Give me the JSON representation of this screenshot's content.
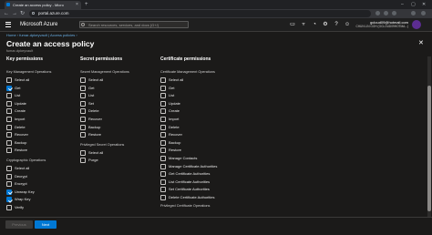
{
  "browser": {
    "tab_title": "Create an access policy - Micro",
    "tab_close": "×",
    "new_tab": "+",
    "url": "portal.azure.com",
    "window_controls": {
      "minimize": "–",
      "maximize": "▢",
      "close": "✕"
    },
    "nav": {
      "back": "←",
      "forward": "→",
      "reload": "↻"
    }
  },
  "azure": {
    "brand": "Microsoft Azure",
    "search_placeholder": "Search resources, services, and docs (G+/)",
    "user_email": "gcloud09@hotmail.com",
    "user_tenant": "CHUN LIN GOH (GCLOUD09HOTMA...)",
    "header_icons": [
      "terminal-icon",
      "bell-icon",
      "gear-icon",
      "help-icon",
      "feedback-icon"
    ]
  },
  "page": {
    "breadcrumb": "Home  ›  fumar-dpkeyvault  |  Access policies  ›",
    "title": "Create an access policy",
    "title_ellipsis": "···",
    "subtitle": "fumar-dpkeyvault",
    "close": "✕"
  },
  "columns": {
    "key": {
      "heading": "Key permissions",
      "groups": [
        {
          "label": "Key Management Operations",
          "items": [
            {
              "label": "Select all",
              "checked": false
            },
            {
              "label": "Get",
              "checked": true
            },
            {
              "label": "List",
              "checked": false
            },
            {
              "label": "Update",
              "checked": false
            },
            {
              "label": "Create",
              "checked": false
            },
            {
              "label": "Import",
              "checked": false
            },
            {
              "label": "Delete",
              "checked": false
            },
            {
              "label": "Recover",
              "checked": false
            },
            {
              "label": "Backup",
              "checked": false
            },
            {
              "label": "Restore",
              "checked": false
            }
          ]
        },
        {
          "label": "Cryptographic Operations",
          "items": [
            {
              "label": "Select all",
              "checked": false
            },
            {
              "label": "Decrypt",
              "checked": false
            },
            {
              "label": "Encrypt",
              "checked": false
            },
            {
              "label": "Unwrap Key",
              "checked": true
            },
            {
              "label": "Wrap Key",
              "checked": true
            },
            {
              "label": "Verify",
              "checked": false
            }
          ]
        }
      ]
    },
    "secret": {
      "heading": "Secret permissions",
      "groups": [
        {
          "label": "Secret Management Operations",
          "items": [
            {
              "label": "Select all",
              "checked": false
            },
            {
              "label": "Get",
              "checked": false
            },
            {
              "label": "List",
              "checked": false
            },
            {
              "label": "Set",
              "checked": false
            },
            {
              "label": "Delete",
              "checked": false
            },
            {
              "label": "Recover",
              "checked": false
            },
            {
              "label": "Backup",
              "checked": false
            },
            {
              "label": "Restore",
              "checked": false
            }
          ]
        },
        {
          "label": "Privileged Secret Operations",
          "items": [
            {
              "label": "Select all",
              "checked": false
            },
            {
              "label": "Purge",
              "checked": false
            }
          ]
        }
      ]
    },
    "certificate": {
      "heading": "Certificate permissions",
      "groups": [
        {
          "label": "Certificate Management Operations",
          "items": [
            {
              "label": "Select all",
              "checked": false
            },
            {
              "label": "Get",
              "checked": false
            },
            {
              "label": "List",
              "checked": false
            },
            {
              "label": "Update",
              "checked": false
            },
            {
              "label": "Create",
              "checked": false
            },
            {
              "label": "Import",
              "checked": false
            },
            {
              "label": "Delete",
              "checked": false
            },
            {
              "label": "Recover",
              "checked": false
            },
            {
              "label": "Backup",
              "checked": false
            },
            {
              "label": "Restore",
              "checked": false
            },
            {
              "label": "Manage Contacts",
              "checked": false
            },
            {
              "label": "Manage Certificate Authorities",
              "checked": false
            },
            {
              "label": "Get Certificate Authorities",
              "checked": false
            },
            {
              "label": "List Certificate Authorities",
              "checked": false
            },
            {
              "label": "Set Certificate Authorities",
              "checked": false
            },
            {
              "label": "Delete Certificate Authorities",
              "checked": false
            }
          ]
        },
        {
          "label": "Privileged Certificate Operations",
          "items": []
        }
      ]
    }
  },
  "footer": {
    "previous": "Previous",
    "next": "Next"
  },
  "colors": {
    "accent": "#0078d4",
    "background": "#1b1a19",
    "link": "#69afe5"
  }
}
